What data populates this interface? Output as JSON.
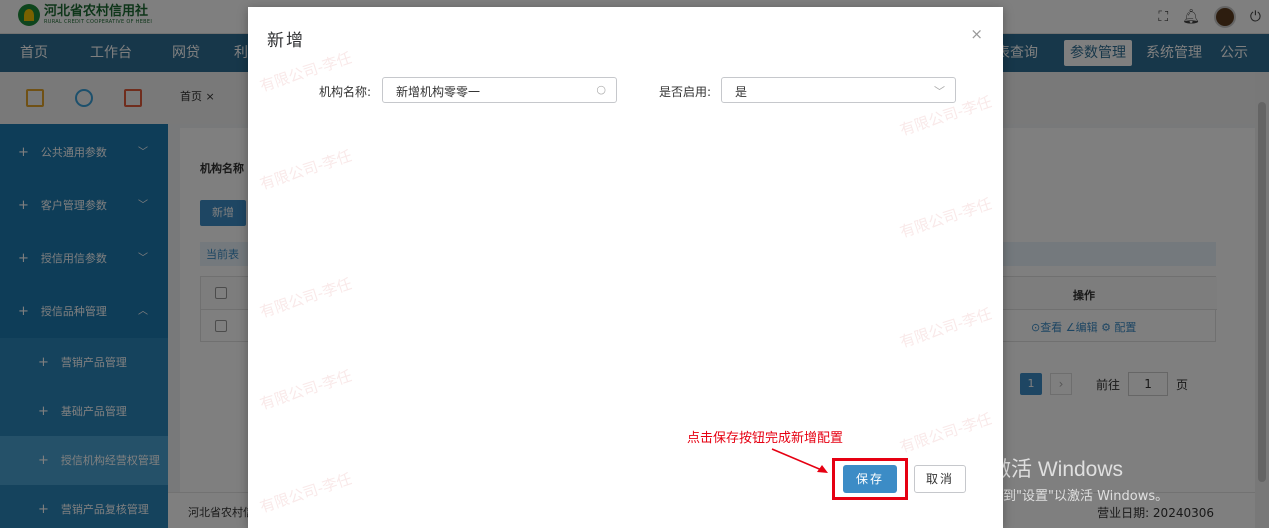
{
  "header": {
    "logo_cn": "河北省农村信用社",
    "logo_en": "RURAL CREDIT COOPERATIVE OF HEBEI"
  },
  "nav": {
    "items": [
      "首页",
      "工作台",
      "网贷",
      "利",
      "表查询",
      "参数管理",
      "系统管理",
      "公示"
    ],
    "active": "参数管理"
  },
  "sidebar": {
    "items": [
      {
        "label": "公共通用参数",
        "chev": "﹀"
      },
      {
        "label": "客户管理参数",
        "chev": "﹀"
      },
      {
        "label": "授信用信参数",
        "chev": "﹀"
      },
      {
        "label": "授信品种管理",
        "chev": "︿"
      }
    ],
    "sub_items": [
      "营销产品管理",
      "基础产品管理",
      "授信机构经营权管理",
      "营销产品复核管理"
    ]
  },
  "main": {
    "tab": "首页 ×",
    "filter_label": "机构名称",
    "add_button": "新增",
    "current_tip": "当前表",
    "table": {
      "op_header": "操作",
      "op_links": "⊙查看  ∠编辑  ⚙ 配置"
    },
    "pager": {
      "page": "1",
      "next": "›",
      "goto_label": "前往",
      "goto_value": "1",
      "page_unit": "页"
    },
    "footer_left": "河北省农村信",
    "footer_right": "营业日期: 20240306"
  },
  "modal": {
    "title": "新增",
    "close": "×",
    "fields": {
      "org_name_label": "机构名称:",
      "org_name_value": "新增机构零零一",
      "enabled_label": "是否启用:",
      "enabled_value": "是"
    },
    "save": "保存",
    "cancel": "取消",
    "annotation": "点击保存按钮完成新增配置"
  },
  "watermark": "有限公司-李任",
  "windows_activation": {
    "line1": "激活 Windows",
    "line2": "转到\"设置\"以激活 Windows。"
  },
  "colors": {
    "nav_bg": "#2f6f95",
    "sidebar_bg": "#1d7ab0",
    "primary": "#3c8cc6",
    "highlight": "#e60012"
  }
}
